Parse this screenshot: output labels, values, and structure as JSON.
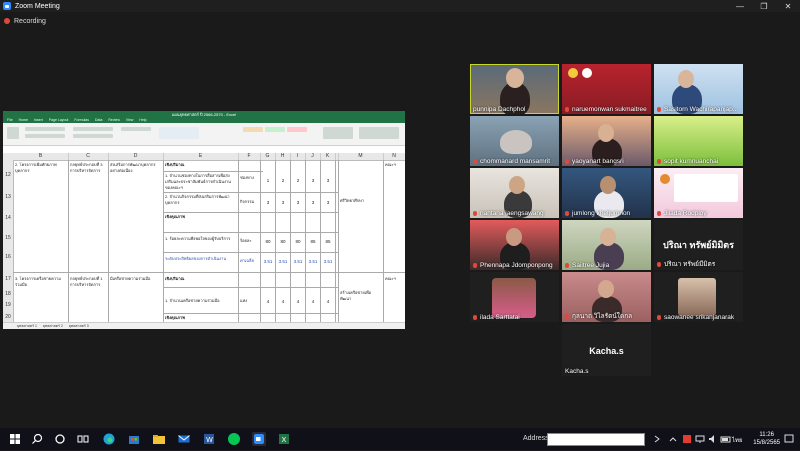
{
  "window": {
    "title": "Zoom Meeting",
    "minimize": "—",
    "maximize": "❐",
    "close": "✕"
  },
  "recording": {
    "label": "Recording"
  },
  "spreadsheet": {
    "title": "แผนยุทธศาสตร์ ปี 2566-2570 - Excel",
    "ribbon_tabs": [
      "File",
      "Home",
      "Insert",
      "Page Layout",
      "Formulas",
      "Data",
      "Review",
      "View",
      "Help"
    ],
    "columns": [
      "B",
      "C",
      "D",
      "E",
      "F",
      "G",
      "H",
      "I",
      "J",
      "K",
      "L",
      "M",
      "N"
    ],
    "rows": [
      "12",
      "13",
      "14",
      "15",
      "16",
      "17",
      "18",
      "19",
      "20"
    ],
    "cells": {
      "b12": "2. โครงการเพิ่มศักยภาพบุคลากร",
      "c12": "กลยุทธ์ประกอบที่ 3 การบริหารจัดการ",
      "d12": "ส่งเสริมการพัฒนาบุคลากรอย่างต่อเนื่อง",
      "e12": "เชิงปริมาณ",
      "e13": "1. จำนวนช่องทางในการสื่อสารเพื่อส่งเสริมและประชาสัมพันธ์การดำเนินงานของคณะฯ",
      "f13": "ช่องทาง",
      "e14": "2. จำนวนกิจกรรมที่ส่งเสริมการพัฒนาบุคลากร",
      "f14": "กิจกรรม",
      "e15": "เชิงคุณภาพ",
      "e16": "1. ร้อยละความพึงพอใจของผู้รับบริการ",
      "f16": "ร้อยละ",
      "e17": "ระดับประสิทธิผลของการดำเนินงาน",
      "f17": "ค่าเฉลี่ย",
      "b18": "3. โครงการเครือข่ายความร่วมมือ",
      "c18": "กลยุทธ์ประกอบที่ 1 การบริหารจัดการ",
      "d18": "มีเครือข่ายความร่วมมือ",
      "e18": "เชิงปริมาณ",
      "e19": "1. จำนวนเครือข่ายความร่วมมือ",
      "f19": "แห่ง",
      "e20": "เชิงคุณภาพ",
      "m13": "ศรีวิทยาศึกษา",
      "n12": "คณะฯ",
      "m18": "สร้างเครือข่ายเพื่อพัฒนา",
      "n18": "คณะฯ"
    },
    "row13_values": [
      "1",
      "2",
      "2",
      "3",
      "3"
    ],
    "row14_values": [
      "3",
      "3",
      "3",
      "3",
      "3"
    ],
    "row16_values": [
      "80",
      "80",
      "80",
      "85",
      "85"
    ],
    "row17_values": [
      "3.51",
      "3.51",
      "3.51",
      "3.51",
      "3.51"
    ],
    "row19_values": [
      "4",
      "4",
      "4",
      "4",
      "4"
    ],
    "sheet_tabs": [
      "ยุทธศาสตร์ 1",
      "ยุทธศาสตร์ 2",
      "ยุทธศาสตร์ 3"
    ]
  },
  "participants": [
    {
      "name": "punnipa Dachphol",
      "muted": false,
      "active": true
    },
    {
      "name": "naruemonwan sukmaitree",
      "muted": true
    },
    {
      "name": "Sasitorn Wachirapanjap...",
      "muted": true
    },
    {
      "name": "chommanard mansamrit",
      "muted": true
    },
    {
      "name": "yaoyanart bangsri",
      "muted": true
    },
    {
      "name": "sopit kumnuanchai",
      "muted": true
    },
    {
      "name": "nantana jaengsawang",
      "muted": true
    },
    {
      "name": "jumlong khetjumnon",
      "muted": true
    },
    {
      "name": "Jiiada Rodploy",
      "muted": true
    },
    {
      "name": "Phennapa Jdomponpong",
      "muted": true
    },
    {
      "name": "Saiitree Jujia",
      "muted": true
    },
    {
      "name": "ปริณา ทรัพย์มีมิตร",
      "muted": true,
      "display": "ปริณา ทรัพย์มิมิตร"
    },
    {
      "name": "ilada Sarttatai",
      "muted": true
    },
    {
      "name": "กุลนาถ วิไลรัตน์ใดกล",
      "muted": true
    },
    {
      "name": "saowanee srikanjanarak",
      "muted": true
    },
    {
      "name": "Kacha.s",
      "muted": false,
      "display": "Kacha.s"
    }
  ],
  "taskbar": {
    "address_label": "Address",
    "time": "11:26",
    "date": "15/8/2565",
    "lang": "ไทย"
  }
}
